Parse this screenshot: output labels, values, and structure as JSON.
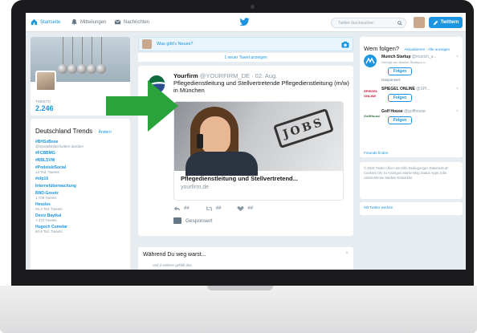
{
  "nav": {
    "home": "Startseite",
    "mentions": "Mitteilungen",
    "messages": "Nachrichten",
    "search_placeholder": "Twitter durchsuchen",
    "tweet_button": "Twittern"
  },
  "profile": {
    "tweets_label": "TWEETS",
    "tweets_count": "2.246"
  },
  "trends": {
    "title": "Deutschland Trends",
    "change": "Ändern",
    "items": [
      {
        "name": "#BHSxBose",
        "meta": "@handelsblatt twittert darüber"
      },
      {
        "name": "#FCBBMG",
        "meta": ""
      },
      {
        "name": "#RBLSVW",
        "meta": ""
      },
      {
        "name": "#PodolskiSocial",
        "meta": "13 Tsd. Tweets"
      },
      {
        "name": "#ofp16",
        "meta": ""
      },
      {
        "name": "Internetüberwachung",
        "meta": ""
      },
      {
        "name": "BND-Gesetz",
        "meta": "1.709 Tweets"
      },
      {
        "name": "Hessles",
        "meta": "25,4 Tsd. Tweets"
      },
      {
        "name": "Deniz Bayikal",
        "meta": "7.472 Tweets"
      },
      {
        "name": "Hugoch Cumelar",
        "meta": "60,6 Tsd. Tweets"
      }
    ]
  },
  "compose": {
    "placeholder": "Was gibt's Neues?",
    "new_tweets": "1 neuer Tweet anzeigen"
  },
  "tweet": {
    "name": "Yourfirm",
    "handle": "@YOURFIRM_DE",
    "date": "· 02. Aug.",
    "text": "Pflegedienstleitung und Stellvertretende Pflegedienstleitung (m/w) in München",
    "stamp": "JOBS",
    "card_title": "Pflegedienstleitung und Stellvertretend...",
    "card_url": "yourfirm.de",
    "reply_count": "##",
    "retweet_count": "##",
    "like_count": "##",
    "promoted": "Gesponsert"
  },
  "while_away": {
    "title": "Während Du weg warst...",
    "close": "×",
    "sub": "und 2 weitere gefällt das"
  },
  "who_to_follow": {
    "title": "Wem folgen?",
    "links": "Aktualisieren · Alle anzeigen",
    "follow_label": "Folgen",
    "close": "×",
    "items": [
      {
        "name": "Munich Startup",
        "handle": "@munich_s...",
        "sub": "Gefolgt von Munich Startups u..."
      },
      {
        "name": "SPIEGEL ONLINE",
        "handle": "@SPI...",
        "sub": ""
      },
      {
        "name": "Golf House",
        "handle": "@golfhouse",
        "sub": ""
      }
    ],
    "promoted": "Gesponsert",
    "find_friends": "Freunde finden"
  },
  "footer": {
    "text": "© 2016 Twitter Über uns Hilfe Bedingungen Datenschutz Cookies Info zu Anzeigen Marke Blog Status Apps Jobs Unternehmen Medien Entwickler",
    "advertise": "Mit Twitter werben"
  },
  "colors": {
    "accent": "#1b95e0",
    "arrow": "#2aa33a"
  }
}
